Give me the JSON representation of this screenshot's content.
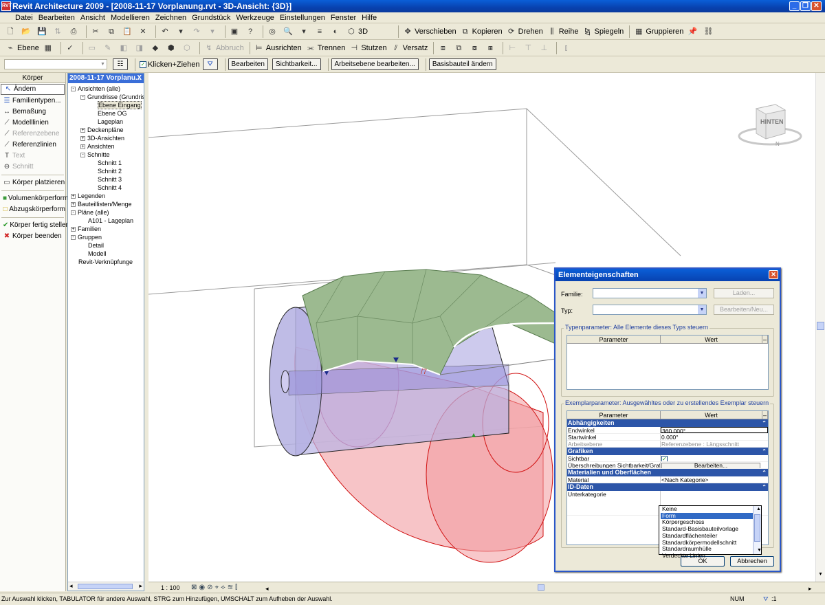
{
  "window": {
    "title": "Revit Architecture 2009 - [2008-11-17 Vorplanung.rvt - 3D-Ansicht: {3D}]"
  },
  "menu": [
    "Datei",
    "Bearbeiten",
    "Ansicht",
    "Modellieren",
    "Zeichnen",
    "Grundstück",
    "Werkzeuge",
    "Einstellungen",
    "Fenster",
    "Hilfe"
  ],
  "toolbar1": {
    "view3d": "3D",
    "move": "Verschieben",
    "copy": "Kopieren",
    "rotate": "Drehen",
    "array": "Reihe",
    "mirror": "Spiegeln",
    "group": "Gruppieren"
  },
  "toolbar2": {
    "level": "Ebene",
    "cancel": "Abbruch",
    "align": "Ausrichten",
    "split": "Trennen",
    "trim": "Stutzen",
    "offset": "Versatz"
  },
  "toolbar3": {
    "click_drag": "Klicken+Ziehen",
    "edit": "Bearbeiten",
    "visibility": "Sichtbarkeit...",
    "work_plane": "Arbeitsebene bearbeiten...",
    "change_host": "Basisbauteil ändern"
  },
  "leftpanel": {
    "header": "Körper",
    "items": [
      {
        "label": "Ändern",
        "icon": "pointer-icon",
        "enabled": true
      },
      {
        "label": "Familientypen...",
        "icon": "family-types-icon",
        "enabled": true
      },
      {
        "label": "Bemaßung",
        "icon": "dimension-icon",
        "enabled": true
      },
      {
        "label": "Modelllinien",
        "icon": "model-lines-icon",
        "enabled": true
      },
      {
        "label": "Referenzebene",
        "icon": "reference-plane-icon",
        "enabled": false
      },
      {
        "label": "Referenzlinien",
        "icon": "reference-lines-icon",
        "enabled": true
      },
      {
        "label": "Text",
        "icon": "text-icon",
        "enabled": false
      },
      {
        "label": "Schnitt",
        "icon": "section-icon",
        "enabled": false
      },
      {
        "label": "Körper platzieren",
        "icon": "place-mass-icon",
        "enabled": true
      },
      {
        "label": "Volumenkörperform",
        "icon": "solid-form-icon",
        "enabled": true
      },
      {
        "label": "Abzugskörperform",
        "icon": "void-form-icon",
        "enabled": true
      },
      {
        "label": "Körper fertig stellen",
        "icon": "finish-mass-icon",
        "enabled": true
      },
      {
        "label": "Körper beenden",
        "icon": "quit-mass-icon",
        "enabled": true
      }
    ]
  },
  "browser": {
    "title": "2008-11-17 Vorplanu...",
    "close": "X",
    "nodes": [
      {
        "label": "Ansichten (alle)",
        "level": 0,
        "exp": "-"
      },
      {
        "label": "Grundrisse (Grundris",
        "level": 1,
        "exp": "-"
      },
      {
        "label": "Ebene Eingang",
        "level": 2,
        "exp": "",
        "selected": true
      },
      {
        "label": "Ebene OG",
        "level": 2,
        "exp": ""
      },
      {
        "label": "Lageplan",
        "level": 2,
        "exp": ""
      },
      {
        "label": "Deckenpläne",
        "level": 1,
        "exp": "+"
      },
      {
        "label": "3D-Ansichten",
        "level": 1,
        "exp": "+"
      },
      {
        "label": "Ansichten",
        "level": 1,
        "exp": "+"
      },
      {
        "label": "Schnitte",
        "level": 1,
        "exp": "-"
      },
      {
        "label": "Schnitt 1",
        "level": 2,
        "exp": ""
      },
      {
        "label": "Schnitt 2",
        "level": 2,
        "exp": ""
      },
      {
        "label": "Schnitt 3",
        "level": 2,
        "exp": ""
      },
      {
        "label": "Schnitt 4",
        "level": 2,
        "exp": ""
      },
      {
        "label": "Legenden",
        "level": 0,
        "exp": "+"
      },
      {
        "label": "Bauteillisten/Menge",
        "level": 0,
        "exp": "+"
      },
      {
        "label": "Pläne (alle)",
        "level": 0,
        "exp": "-"
      },
      {
        "label": "A101 - Lageplan",
        "level": 1,
        "exp": ""
      },
      {
        "label": "Familien",
        "level": 0,
        "exp": "+"
      },
      {
        "label": "Gruppen",
        "level": 0,
        "exp": "-"
      },
      {
        "label": "Detail",
        "level": 1,
        "exp": ""
      },
      {
        "label": "Modell",
        "level": 1,
        "exp": ""
      },
      {
        "label": "Revit-Verknüpfunge",
        "level": 0,
        "exp": ""
      }
    ]
  },
  "viewcube": {
    "face": "HINTEN",
    "compass": "N"
  },
  "viewbar": {
    "scale": "1 : 100"
  },
  "status": {
    "text": "Zur Auswahl klicken, TABULATOR für andere Auswahl, STRG zum Hinzufügen, UMSCHALT zum Aufheben der Auswahl.",
    "num": "NUM",
    "filter": ":1"
  },
  "dialog": {
    "title": "Elementeigenschaften",
    "family_label": "Familie:",
    "type_label": "Typ:",
    "load_btn": "Laden...",
    "edit_new_btn": "Bearbeiten/Neu...",
    "type_params_label": "Typenparameter: Alle Elemente dieses Typs steuern",
    "instance_params_label": "Exemplarparameter: Ausgewähltes oder zu erstellendes Exemplar steuern",
    "col_param": "Parameter",
    "col_value": "Wert",
    "categories": [
      {
        "name": "Abhängigkeiten",
        "rows": [
          {
            "param": "Endwinkel",
            "value": "360.000°",
            "editing": true
          },
          {
            "param": "Startwinkel",
            "value": "0.000°"
          },
          {
            "param": "Arbeitsebene",
            "value": "Referenzebene : Längsschnitt",
            "disabled": true
          }
        ]
      },
      {
        "name": "Grafiken",
        "rows": [
          {
            "param": "Sichtbar",
            "value": "",
            "checkbox": true
          },
          {
            "param": "Überschreibungen Sichtbarkeit/Grafik",
            "value": "Bearbeiten...",
            "button": true
          }
        ]
      },
      {
        "name": "Materialien und Oberflächen",
        "rows": [
          {
            "param": "Material",
            "value": "<Nach Kategorie>"
          }
        ]
      },
      {
        "name": "ID-Daten",
        "rows": [
          {
            "param": "Unterkategorie",
            "value": ""
          }
        ]
      }
    ],
    "dropdown_options": [
      "Keine",
      "Form",
      "Körpergeschoss",
      "Standard-Basisbauteilvorlage",
      "Standardflächenteiler",
      "Standardkörpermodellschnitt",
      "Standardraumhülle",
      "Verdeckte Linien"
    ],
    "dropdown_selected": "Form",
    "ok": "OK",
    "cancel": "Abbrechen"
  }
}
